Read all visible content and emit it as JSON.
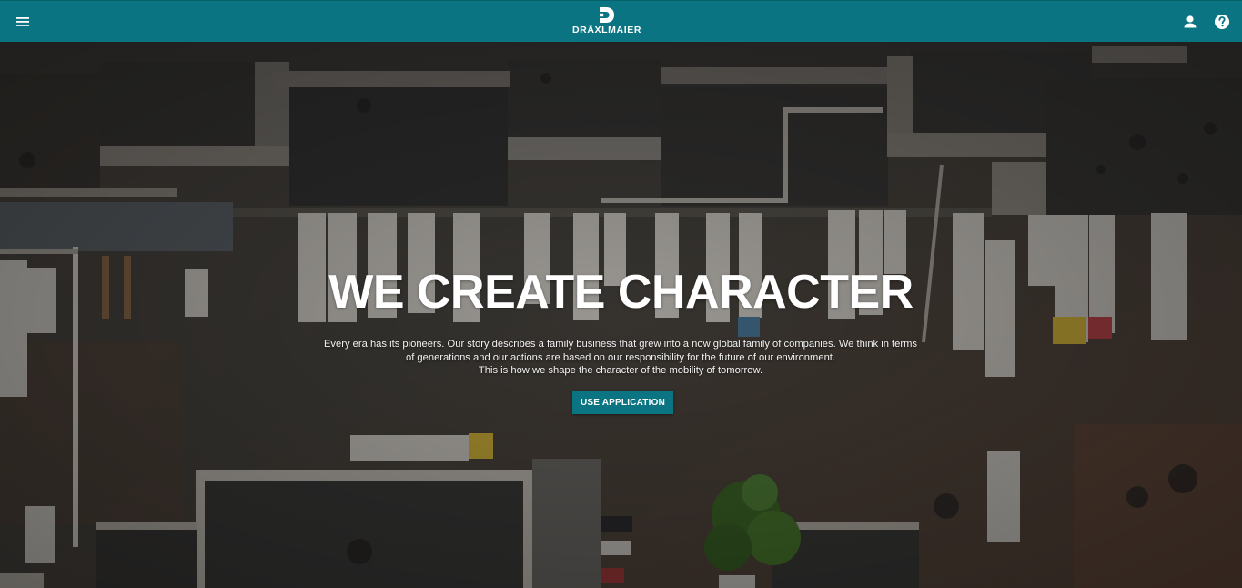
{
  "header": {
    "logo_text": "DRÄXLMAIER",
    "icons": {
      "menu": "menu-icon",
      "logo": "draexlmaier-logo-mark",
      "user": "user-icon",
      "help": "help-icon"
    },
    "colors": {
      "bar": "#0a7482",
      "icon": "#ffffff"
    }
  },
  "hero": {
    "title": "WE CREATE CHARACTER",
    "text_lines": [
      "Every era has its pioneers. Our story describes a family business that grew into a now global family of companies. We think in terms",
      "of generations and our actions are based on our responsibility for the future of our environment.",
      "This is how we shape the character of the mobility of tomorrow."
    ],
    "button_label": "USE APPLICATION",
    "background_image": "aerial view of logistics warehouse with parked truck trailers",
    "colors": {
      "accent": "#0a7482",
      "text": "#ffffff"
    }
  }
}
